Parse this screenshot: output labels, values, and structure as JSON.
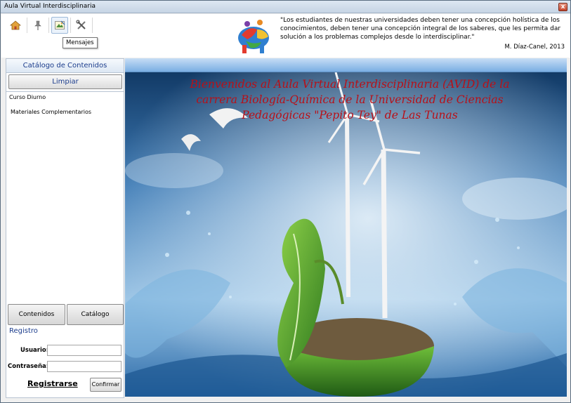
{
  "window": {
    "title": "Aula Virtual Interdisciplinaria",
    "close_label": "x"
  },
  "toolbar": {
    "buttons": [
      {
        "icon": "home-icon"
      },
      {
        "icon": "pin-icon"
      },
      {
        "icon": "message-icon"
      },
      {
        "icon": "tools-icon"
      }
    ],
    "tooltip": "Mensajes"
  },
  "header": {
    "quote": "\"Los estudiantes de nuestras universidades deben tener una concepción holística de los conocimientos, deben tener una concepción integral de los saberes, que les permita dar solución a los problemas complejos desde lo interdisciplinar.\"",
    "author": "M. Díaz-Canel, 2013"
  },
  "sidebar": {
    "header": "Catálogo de Contenidos",
    "clear_label": "Limpiar",
    "items": [
      {
        "label": "Curso Diurno"
      },
      {
        "label": "Materiales Complementarios"
      }
    ],
    "tabs": [
      {
        "label": "Contenidos"
      },
      {
        "label": "Catálogo"
      }
    ]
  },
  "login": {
    "section_label": "Registro",
    "user_label": "Usuario:",
    "user_value": "",
    "password_label": "Contraseña:",
    "password_value": "",
    "register_label": "Registrarse",
    "confirm_label": "Confirmar"
  },
  "main": {
    "welcome_lines": [
      "Bienvenidos al Aula Virtual Interdisciplinaria (AVID) de la",
      "carrera Biología-Química de la Universidad de Ciencias",
      "Pedagógicas \"Pepito Tey\" de Las Tunas"
    ]
  },
  "colors": {
    "accent": "#1b3c8c",
    "welcome_text": "#b81018",
    "header_band": "#7aaee3"
  }
}
